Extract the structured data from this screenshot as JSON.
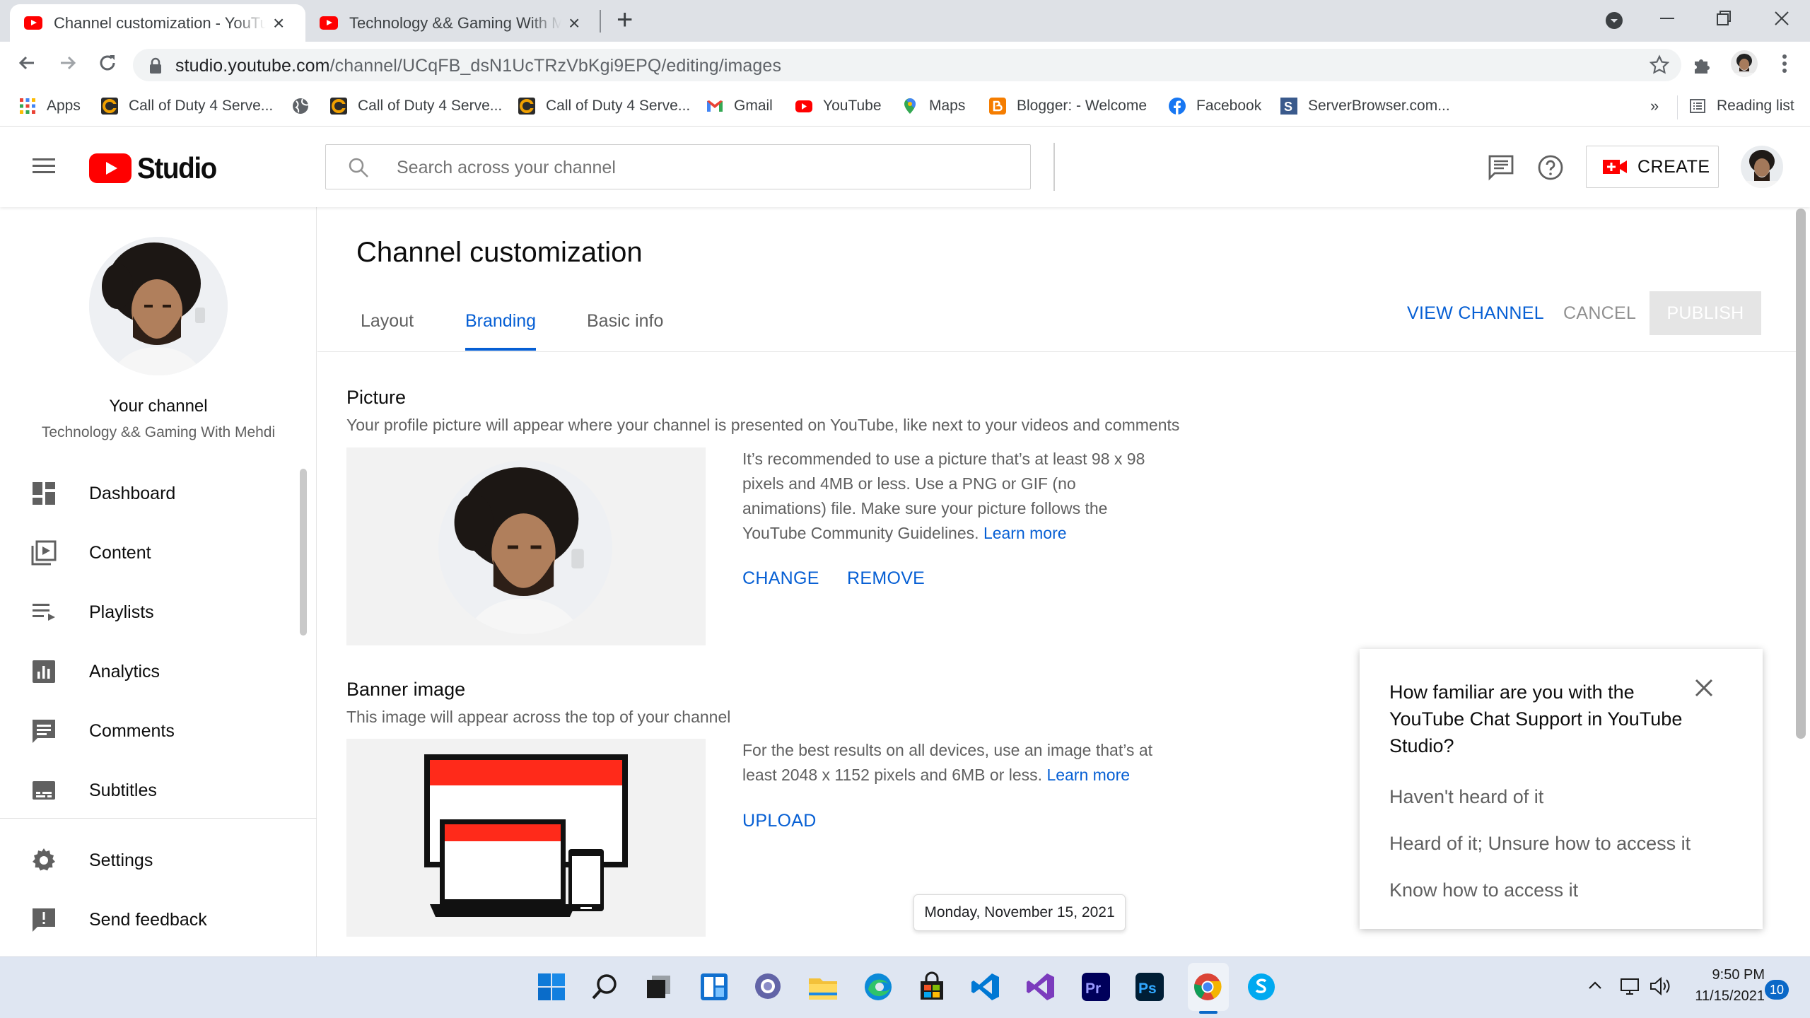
{
  "browser": {
    "tabs": [
      {
        "title": "Channel customization - YouTube Studio",
        "active": true
      },
      {
        "title": "Technology && Gaming With Mehdi - YouTube",
        "active": false
      }
    ],
    "url_host": "studio.youtube.com",
    "url_path": "/channel/UCqFB_dsN1UcTRzVbKgi9EPQ/editing/images",
    "bookmarks": [
      {
        "label": "Apps",
        "icon": "apps-grid-icon"
      },
      {
        "label": "Call of Duty 4 Serve...",
        "icon": "cod-icon"
      },
      {
        "label": "",
        "icon": "globe-icon"
      },
      {
        "label": "Call of Duty 4 Serve...",
        "icon": "cod-icon"
      },
      {
        "label": "Call of Duty 4 Serve...",
        "icon": "cod-icon"
      },
      {
        "label": "Gmail",
        "icon": "gmail-icon"
      },
      {
        "label": "YouTube",
        "icon": "youtube-icon"
      },
      {
        "label": "Maps",
        "icon": "maps-icon"
      },
      {
        "label": "Blogger: - Welcome",
        "icon": "blogger-icon"
      },
      {
        "label": "Facebook",
        "icon": "facebook-icon"
      },
      {
        "label": "ServerBrowser.com...",
        "icon": "serverbrowser-icon"
      }
    ],
    "overflow": "»",
    "reading_list": "Reading list"
  },
  "studio": {
    "logo_text": "Studio",
    "search_placeholder": "Search across your channel",
    "create_label": "CREATE"
  },
  "sidebar": {
    "your_channel": "Your channel",
    "channel_name": "Technology && Gaming With Mehdi",
    "items": [
      {
        "label": "Dashboard",
        "icon": "dashboard-icon"
      },
      {
        "label": "Content",
        "icon": "content-icon"
      },
      {
        "label": "Playlists",
        "icon": "playlists-icon"
      },
      {
        "label": "Analytics",
        "icon": "analytics-icon"
      },
      {
        "label": "Comments",
        "icon": "comments-icon"
      },
      {
        "label": "Subtitles",
        "icon": "subtitles-icon"
      },
      {
        "label": "Settings",
        "icon": "settings-icon"
      },
      {
        "label": "Send feedback",
        "icon": "feedback-icon"
      }
    ]
  },
  "main": {
    "title": "Channel customization",
    "tabs": [
      "Layout",
      "Branding",
      "Basic info"
    ],
    "active_tab": "Branding",
    "view_channel": "VIEW CHANNEL",
    "cancel": "CANCEL",
    "publish": "PUBLISH",
    "picture": {
      "title": "Picture",
      "desc": "Your profile picture will appear where your channel is presented on YouTube, like next to your videos and comments",
      "info": "It’s recommended to use a picture that’s at least 98 x 98 pixels and 4MB or less. Use a PNG or GIF (no animations) file. Make sure your picture follows the YouTube Community Guidelines.",
      "learn_more": "Learn more",
      "change": "CHANGE",
      "remove": "REMOVE"
    },
    "banner": {
      "title": "Banner image",
      "desc": "This image will appear across the top of your channel",
      "info": "For the best results on all devices, use an image that’s at least 2048 x 1152 pixels and 6MB or less.",
      "learn_more": "Learn more",
      "upload": "UPLOAD"
    }
  },
  "survey": {
    "question": "How familiar are you with the YouTube Chat Support in YouTube Studio?",
    "options": [
      "Haven't heard of it",
      "Heard of it; Unsure how to access it",
      "Know how to access it"
    ]
  },
  "tooltip": "Monday, November 15, 2021",
  "taskbar": {
    "time": "9:50 PM",
    "date": "11/15/2021",
    "notifications": "10",
    "apps": [
      "windows-start-icon",
      "search-icon",
      "task-view-icon",
      "widgets-icon",
      "teams-chat-icon",
      "file-explorer-icon",
      "edge-icon",
      "store-icon",
      "vscode-icon",
      "visual-studio-icon",
      "premiere-icon",
      "photoshop-icon",
      "chrome-icon",
      "skype-icon"
    ]
  },
  "colors": {
    "accent_blue": "#065fd4",
    "youtube_red": "#ff0000",
    "muted_text": "#606060"
  }
}
